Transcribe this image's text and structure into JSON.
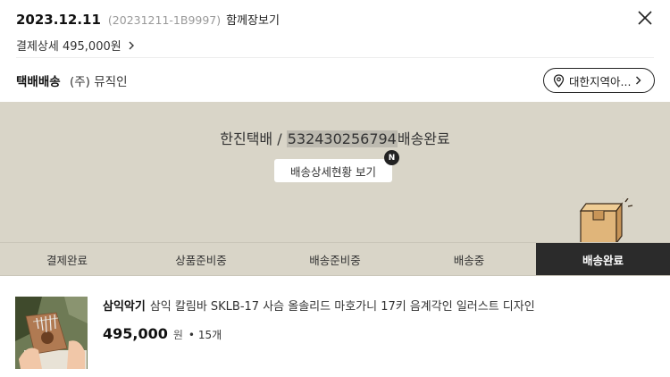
{
  "header": {
    "date": "2023.12.11",
    "order_number": "(20231211-1B9997)",
    "together_label": "함께장보기",
    "payment_detail_label": "결제상세 495,000원"
  },
  "shipping": {
    "method": "택배배송",
    "seller": "(주) 뮤직인",
    "region_button": "대한지역아..."
  },
  "status": {
    "carrier": "한진택배 /",
    "tracking_number": "532430256794",
    "delivery_state": "배송완료",
    "detail_button": "배송상세현황 보기",
    "new_badge": "N"
  },
  "steps": [
    {
      "label": "결제완료",
      "active": false
    },
    {
      "label": "상품준비중",
      "active": false
    },
    {
      "label": "배송준비중",
      "active": false
    },
    {
      "label": "배송중",
      "active": false
    },
    {
      "label": "배송완료",
      "active": true
    }
  ],
  "product": {
    "brand": "삼익악기",
    "name": "삼익 칼림바 SKLB-17 사슴 올솔리드 마호가니 17키 음계각인 일러스트 디자인",
    "price": "495,000",
    "currency": "원",
    "quantity": "• 15개"
  },
  "colors": {
    "panel_bg": "#d9d5c8",
    "active_step_bg": "#2b2b2b",
    "tracking_highlight": "#bdbab0"
  }
}
